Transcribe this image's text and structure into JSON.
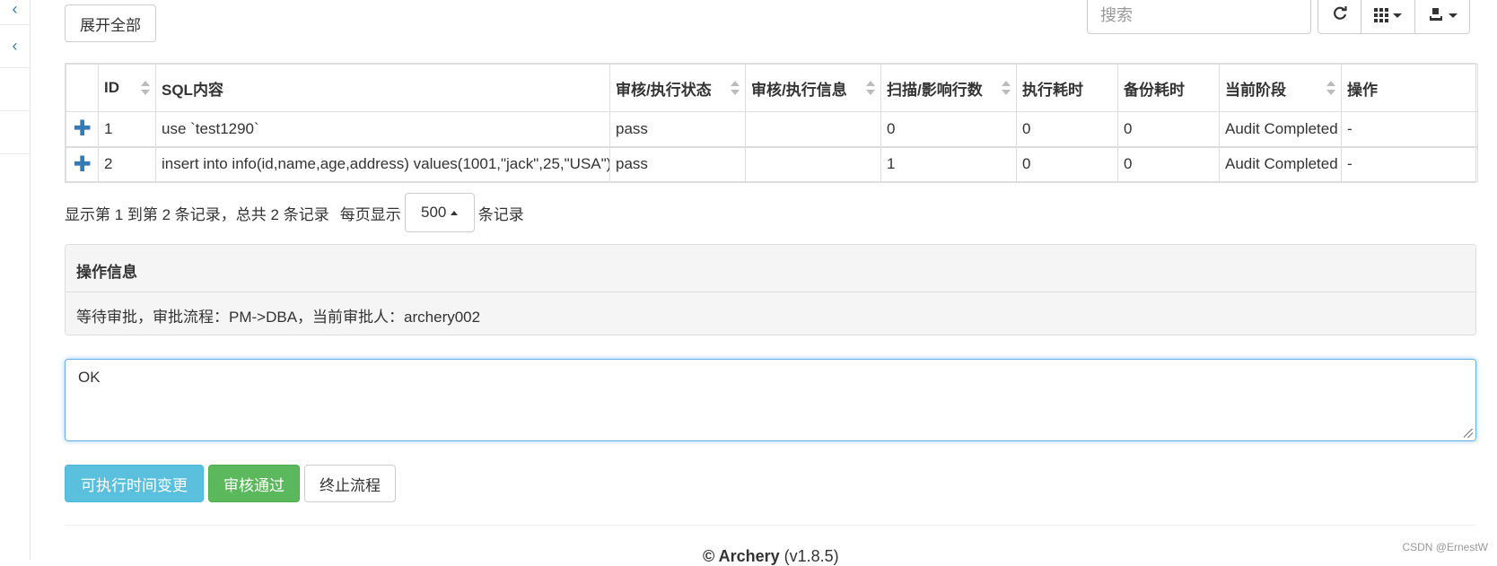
{
  "sidebar": {
    "collapse_glyphs": [
      "‹",
      "‹",
      "",
      ""
    ]
  },
  "toolbar": {
    "expand_all": "展开全部",
    "search_placeholder": "搜索",
    "tools": [
      "refresh-icon",
      "columns-icon",
      "export-icon"
    ]
  },
  "table": {
    "columns": [
      "ID",
      "SQL内容",
      "审核/执行状态",
      "审核/执行信息",
      "扫描/影响行数",
      "执行耗时",
      "备份耗时",
      "当前阶段",
      "操作"
    ],
    "rows": [
      {
        "id": "1",
        "sql": "use `test1290`",
        "status": "pass",
        "info": "",
        "affected": "0",
        "exec_time": "0",
        "backup_time": "0",
        "stage": "Audit Completed",
        "action": "-"
      },
      {
        "id": "2",
        "sql": "insert into info(id,name,age,address) values(1001,\"jack\",25,\"USA\")",
        "status": "pass",
        "info": "",
        "affected": "1",
        "exec_time": "0",
        "backup_time": "0",
        "stage": "Audit Completed",
        "action": "-"
      }
    ]
  },
  "pagination": {
    "summary": "显示第 1 到第 2 条记录，总共 2 条记录",
    "per_page_prefix": "每页显示",
    "page_size": "500",
    "per_page_suffix": "条记录"
  },
  "info_panel": {
    "title": "操作信息",
    "body": "等待审批，审批流程：PM->DBA，当前审批人：archery002"
  },
  "remark": {
    "value": "OK"
  },
  "actions": {
    "change_time": "可执行时间变更",
    "approve": "审核通过",
    "terminate": "终止流程"
  },
  "footer": {
    "brand": "© Archery",
    "version": "(v1.8.5)"
  },
  "watermark": "CSDN @ErnestW",
  "colors": {
    "info": "#5bc0de",
    "success": "#5cb85c",
    "link": "#337ab7"
  }
}
